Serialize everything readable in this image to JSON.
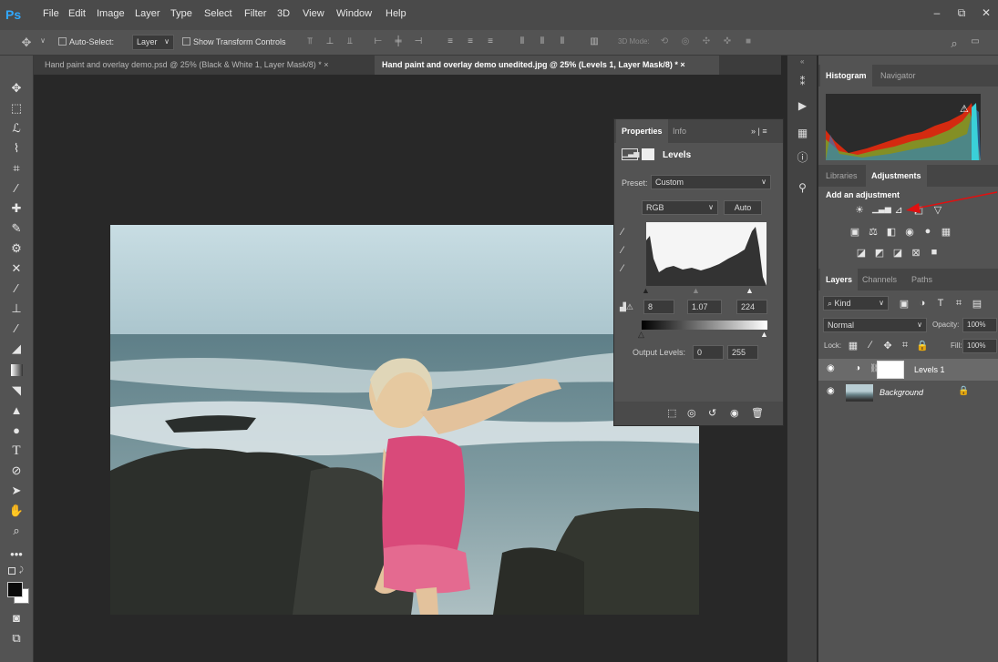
{
  "app": {
    "logo": "Ps"
  },
  "menu": [
    "File",
    "Edit",
    "Image",
    "Layer",
    "Type",
    "Select",
    "Filter",
    "3D",
    "View",
    "Window",
    "Help"
  ],
  "window_controls": [
    "–",
    "⧉",
    "✕"
  ],
  "options_bar": {
    "auto_select_label": "Auto-Select:",
    "auto_select_value": "Layer",
    "show_transform_label": "Show Transform Controls",
    "mode_3d_label": "3D Mode:"
  },
  "tabs": [
    {
      "label": "Hand paint and overlay demo.psd @ 25% (Black & White 1, Layer Mask/8) *"
    },
    {
      "label": "Hand paint and overlay demo unedited.jpg @ 25% (Levels 1, Layer Mask/8) *"
    }
  ],
  "tab_close": "×",
  "properties": {
    "tabs": [
      "Properties",
      "Info"
    ],
    "title": "Levels",
    "preset_label": "Preset:",
    "preset_value": "Custom",
    "channel_value": "RGB",
    "auto_button": "Auto",
    "input_black": "8",
    "input_gamma": "1.07",
    "input_white": "224",
    "output_label": "Output Levels:",
    "output_black": "0",
    "output_white": "255"
  },
  "right_panel": {
    "histogram_tabs": [
      "Histogram",
      "Navigator"
    ],
    "adjust_tabs": [
      "Libraries",
      "Adjustments"
    ],
    "add_adjustment_label": "Add an adjustment",
    "layers_tabs": [
      "Layers",
      "Channels",
      "Paths"
    ],
    "kind_label": "Kind",
    "blend_mode": "Normal",
    "opacity_label": "Opacity:",
    "opacity_value": "100%",
    "lock_label": "Lock:",
    "fill_label": "Fill:",
    "fill_value": "100%",
    "layers": [
      {
        "name": "Levels 1"
      },
      {
        "name": "Background"
      }
    ]
  },
  "colors": {
    "accent": "#31a8ff",
    "arrow": "#e01010",
    "panel": "#535353",
    "canvas": "#282828"
  }
}
